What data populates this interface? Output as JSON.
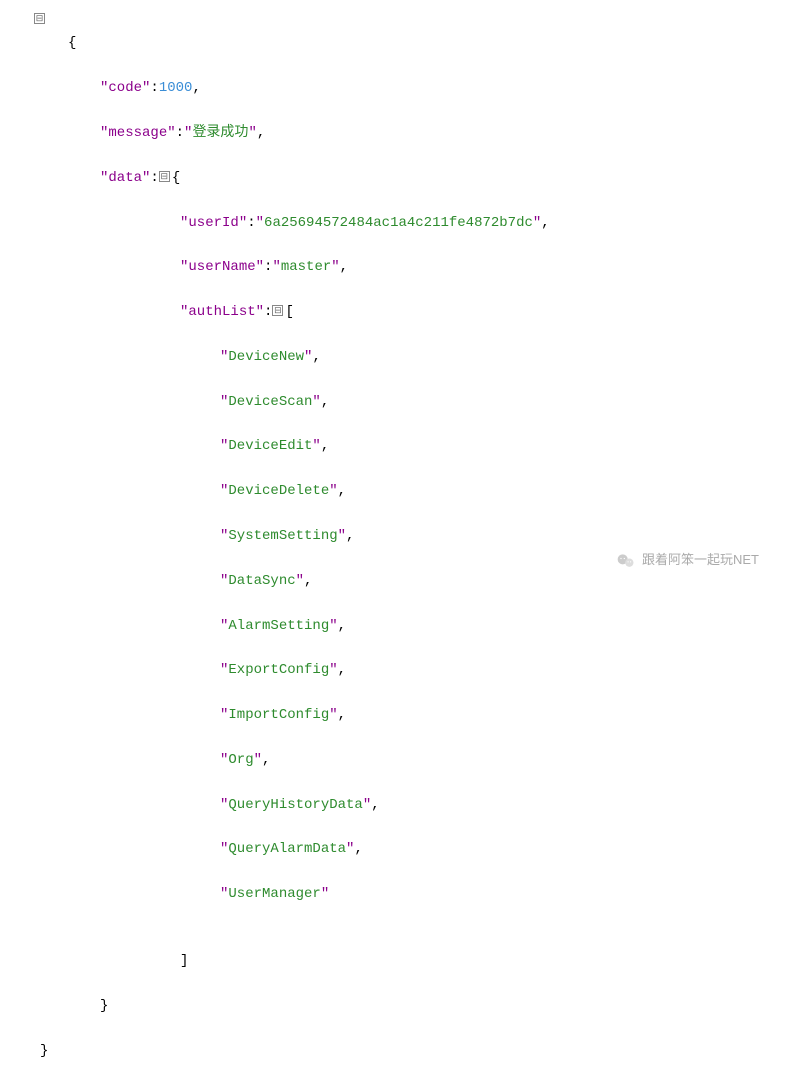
{
  "json": {
    "code_key": "code",
    "code_value": "1000",
    "message_key": "message",
    "message_value": "登录成功",
    "data_key": "data",
    "userId_key": "userId",
    "userId_value": "6a25694572484ac1a4c211fe4872b7dc",
    "userName_key": "userName",
    "userName_value": "master",
    "authList_key": "authList",
    "authList": [
      "DeviceNew",
      "DeviceScan",
      "DeviceEdit",
      "DeviceDelete",
      "SystemSetting",
      "DataSync",
      "AlarmSetting",
      "ExportConfig",
      "ImportConfig",
      "Org",
      "QueryHistoryData",
      "QueryAlarmData",
      "UserManager"
    ]
  },
  "toggle_symbol": "⊟",
  "footer": {
    "text": "跟着阿笨一起玩NET"
  }
}
